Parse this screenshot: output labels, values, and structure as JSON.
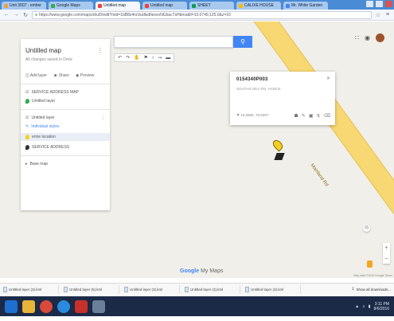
{
  "browser": {
    "tabs": [
      {
        "label": "Unit 3007 - ember",
        "color": "#e6a23c"
      },
      {
        "label": "Google Maps",
        "color": "#34a853"
      },
      {
        "label": "Untitled map",
        "color": "#ea4335"
      },
      {
        "label": "Untitled map",
        "color": "#ea4335"
      },
      {
        "label": "SHEET",
        "color": "#0f9d58"
      },
      {
        "label": "CALIXE HOUSE",
        "color": "#fbbc05"
      },
      {
        "label": "Mr. White Garden",
        "color": "#4285f4"
      }
    ],
    "url": "https://www.google.com/maps/d/u/0/edit?mid=1bB8z4nrUudlsdIlesvoNGbuc7sHbms&ll=10.0749,125.0&z=16"
  },
  "map": {
    "search_placeholder": "",
    "road_name": "Mainland Rd",
    "tools": [
      "hand-icon",
      "marker-icon",
      "line-icon",
      "route-icon",
      "ruler-icon"
    ]
  },
  "panel": {
    "title": "Untitled map",
    "subtitle": "All changes saved in Drive",
    "actions": [
      "Add layer",
      "Share",
      "Preview"
    ],
    "layer0": {
      "label": "SERVICE ADDRESS MAP",
      "item": "Untitled layer"
    },
    "layer1": {
      "label": "Untitled layer",
      "style_link": "Individual styles",
      "selected_item": "ernie location",
      "item2": "SERVICE ADDRESS"
    },
    "base_map": "Base map"
  },
  "infocard": {
    "title": "0154340P003",
    "subtitle": "SOUTHS DEA RD, HAMCE",
    "footer": "⚑ 10.0896, 76.5097"
  },
  "logo": {
    "brand": "Google",
    "product": "My Maps"
  },
  "attribution": "Map data ©2016 Google  Terms",
  "downloads": [
    "Untitled layer (3).kml",
    "Untitled layer (5).kml",
    "Untitled layer (3).kml",
    "Untitled layer (3).kml",
    "Untitled layer (3).kml"
  ],
  "show_all": "Show all downloads...",
  "taskbar": {
    "apps": [
      {
        "name": "windows-start-icon",
        "color": "#1f6fd1"
      },
      {
        "name": "file-explorer-icon",
        "color": "#e9b43a"
      },
      {
        "name": "chrome-icon",
        "color": "#d94a3a"
      },
      {
        "name": "internet-explorer-icon",
        "color": "#2a8adf"
      },
      {
        "name": "acrobat-icon",
        "color": "#c8302c"
      },
      {
        "name": "media-icon",
        "color": "#6a7f99"
      }
    ],
    "time": "3:11 PM",
    "date": "8/6/2016"
  }
}
